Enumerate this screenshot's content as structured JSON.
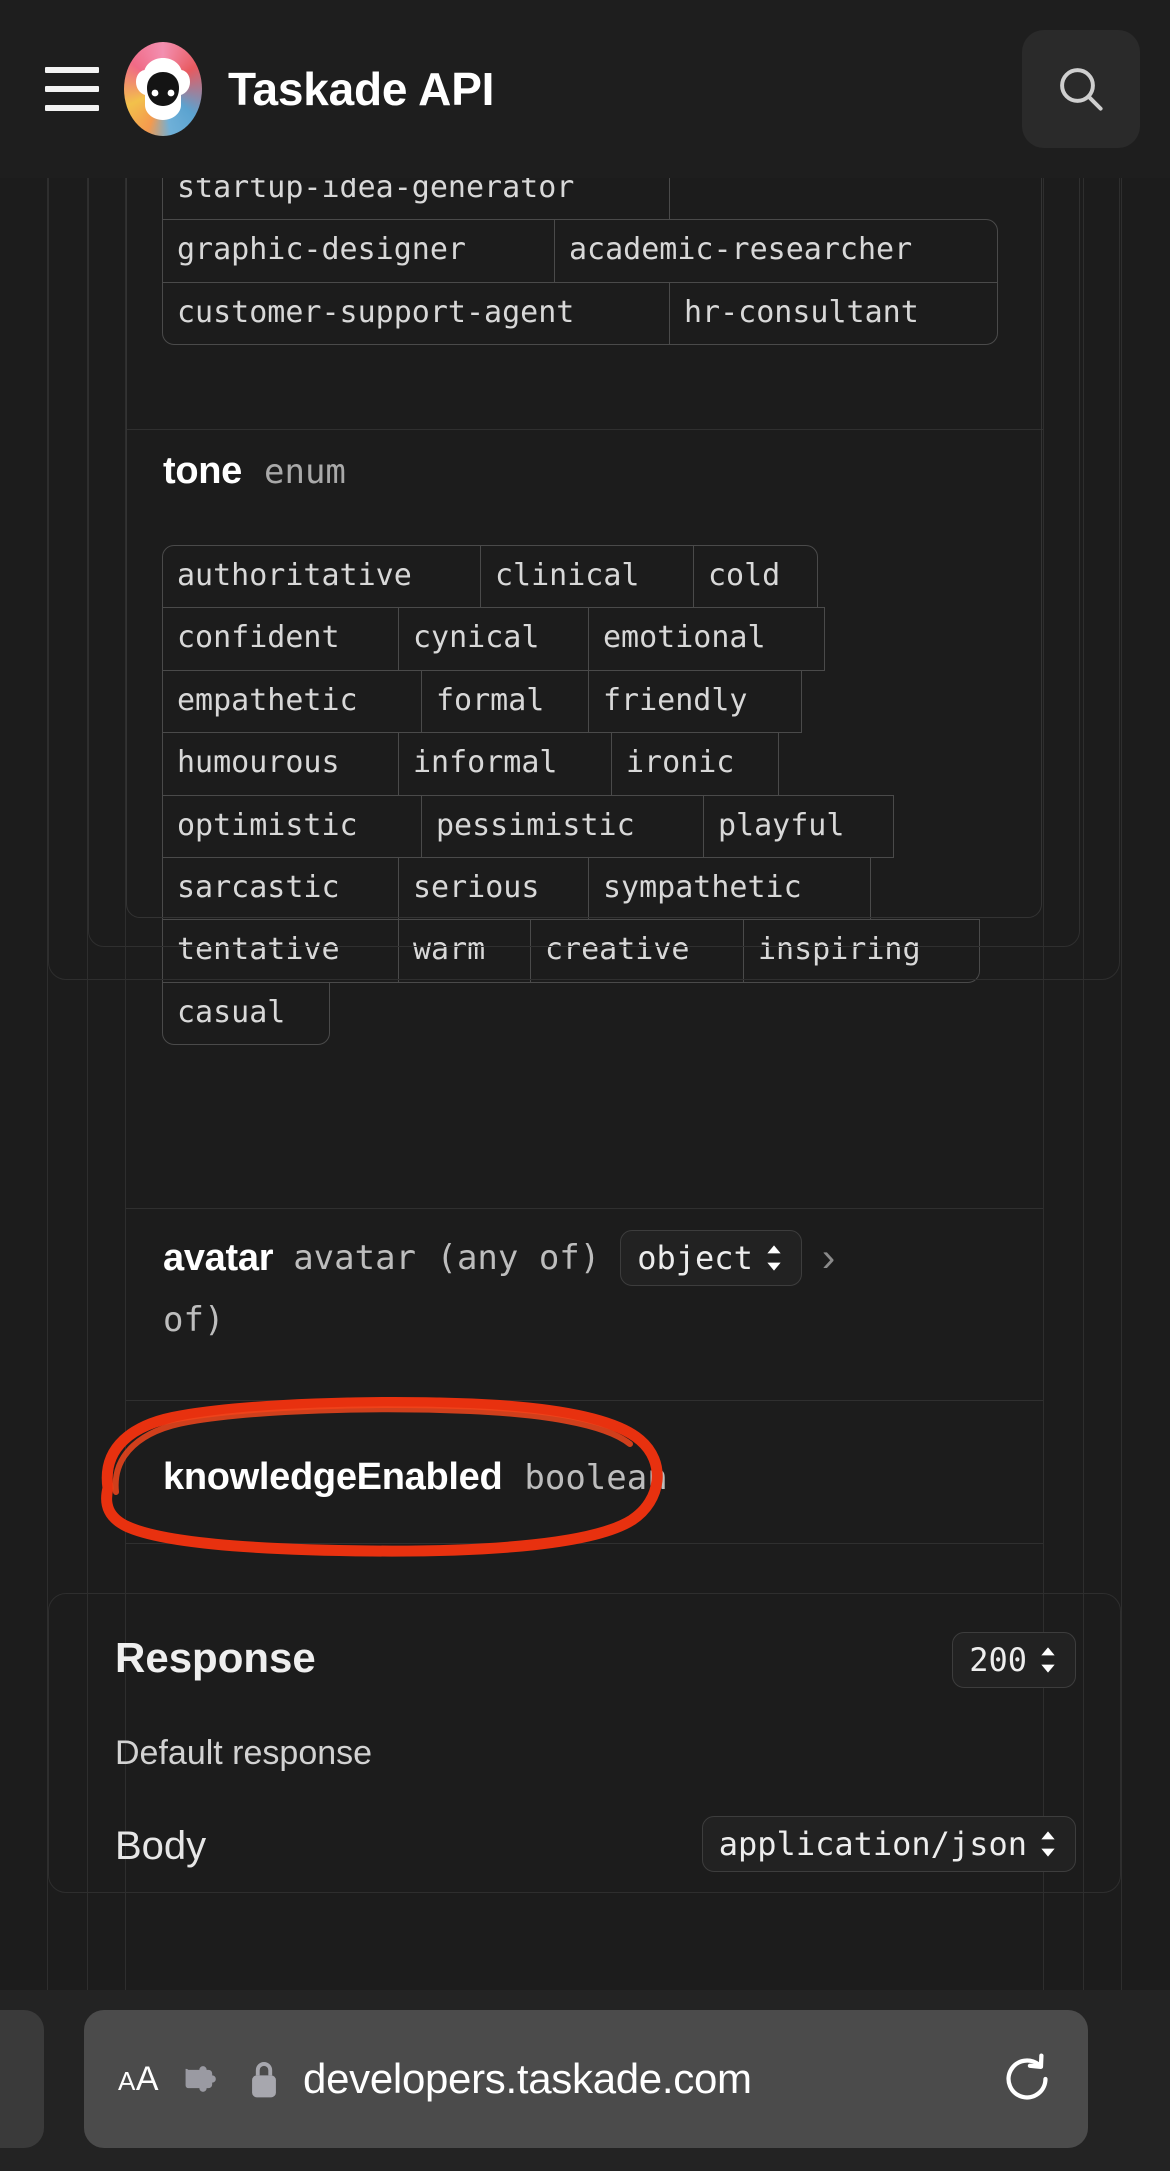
{
  "header": {
    "menu_icon": "hamburger-menu-icon",
    "logo_icon": "taskade-sheep-logo",
    "title": "Taskade API",
    "search_icon": "search-icon"
  },
  "api_params": {
    "role_enum_tail": {
      "rows": [
        [
          "startup-idea-generator"
        ],
        [
          "graphic-designer",
          "academic-researcher"
        ],
        [
          "customer-support-agent",
          "hr-consultant"
        ]
      ]
    },
    "tone_field": {
      "name": "tone",
      "type": "enum",
      "rows": [
        [
          "authoritative",
          "clinical",
          "cold"
        ],
        [
          "confident",
          "cynical",
          "emotional"
        ],
        [
          "empathetic",
          "formal",
          "friendly"
        ],
        [
          "humourous",
          "informal",
          "ironic"
        ],
        [
          "optimistic",
          "pessimistic",
          "playful"
        ],
        [
          "sarcastic",
          "serious",
          "sympathetic"
        ],
        [
          "tentative",
          "warm",
          "creative",
          "inspiring"
        ],
        [
          "casual"
        ]
      ]
    },
    "avatar_field": {
      "name": "avatar",
      "type": "avatar (any of)",
      "selected_variant": "object",
      "expand_icon": "chevron-right-icon",
      "dropdown_icon": "chevron-up-down-icon"
    },
    "knowledge_field": {
      "name": "knowledgeEnabled",
      "type": "boolean",
      "annotation": "red-circle-highlight"
    }
  },
  "response": {
    "title": "Response",
    "status_code": "200",
    "status_dropdown_icon": "chevron-up-down-icon",
    "description": "Default response",
    "body_label": "Body",
    "content_type": "application/json",
    "content_type_dropdown_icon": "chevron-up-down-icon"
  },
  "browser_bar": {
    "text_size_label": "AA",
    "extensions_icon": "puzzle-piece-icon",
    "lock_icon": "lock-icon",
    "url": "developers.taskade.com",
    "reload_icon": "reload-icon",
    "prev_tab_icon": "previous-tab-edge"
  },
  "colors": {
    "page_bg": "#1c1c1c",
    "topbar_bg": "#1e1e1e",
    "annotation_red": "#e8310f",
    "url_bar_bg": "#4b4b4b",
    "border": "#4a4a4a"
  }
}
